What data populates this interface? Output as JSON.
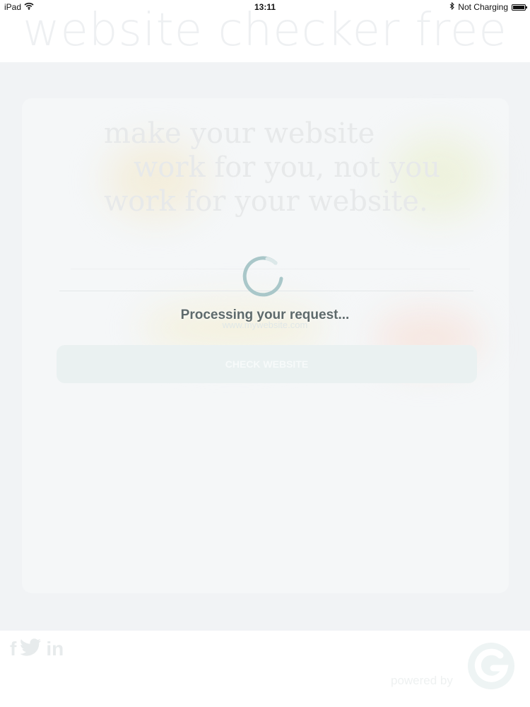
{
  "status_bar": {
    "device": "iPad",
    "time": "13:11",
    "battery_status": "Not Charging",
    "icons": [
      "wifi-icon",
      "bluetooth-icon",
      "battery-icon"
    ]
  },
  "header": {
    "site_title": "website checker free"
  },
  "hero": {
    "tagline_line1": "make your website",
    "tagline_line2": "work for you, not you",
    "tagline_line3": "work for your website."
  },
  "form": {
    "url_placeholder": "www.mywebsite.com",
    "submit_label": "CHECK WEBSITE"
  },
  "overlay": {
    "message": "Processing your request..."
  },
  "footer": {
    "social_icons": [
      "facebook-icon",
      "twitter-icon",
      "linkedin-icon"
    ],
    "powered_by_label": "powered by"
  },
  "colors": {
    "overlay_text": "#5e6a6c",
    "spinner": "#a9c7c9",
    "faded_background": "#f1f3f5"
  }
}
